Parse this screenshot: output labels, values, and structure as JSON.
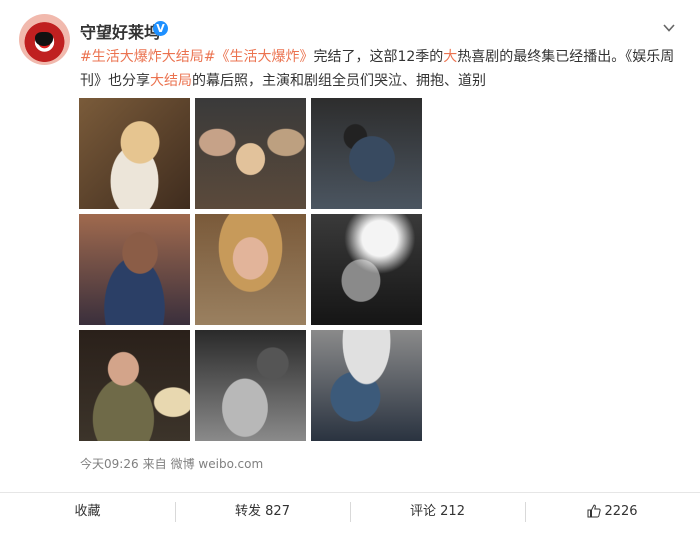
{
  "post": {
    "user": {
      "name": "守望好莱坞",
      "verified_mark": "V"
    },
    "text": {
      "tag1": "#生活大爆炸大结局#",
      "title_ref": "《生活大爆炸》",
      "part1": "完结了，这部12季的",
      "kw1": "大",
      "part2": "热喜剧的最终集已经播出。《娱乐周刊》也分享",
      "kw2": "大结局",
      "part3": "的幕后照，主演和剧组全员们哭泣、拥抱、道别"
    },
    "photos": [
      {
        "desc": "photo-1"
      },
      {
        "desc": "photo-2"
      },
      {
        "desc": "photo-3"
      },
      {
        "desc": "photo-4"
      },
      {
        "desc": "photo-5"
      },
      {
        "desc": "photo-6"
      },
      {
        "desc": "photo-7"
      },
      {
        "desc": "photo-8"
      },
      {
        "desc": "photo-9"
      }
    ],
    "meta": {
      "time": "今天09:26",
      "from": "来自",
      "source": "微博 weibo.com"
    }
  },
  "actions": {
    "favorite": "收藏",
    "repost": "转发 827",
    "comment": "评论 212",
    "like_count": "2226"
  },
  "colors": {
    "link": "#eb7350",
    "verified": "#1e90ff",
    "meta": "#808080"
  },
  "icons": {
    "menu": "chevron-down-icon",
    "verified": "verified-badge-icon",
    "like": "thumbs-up-icon"
  }
}
